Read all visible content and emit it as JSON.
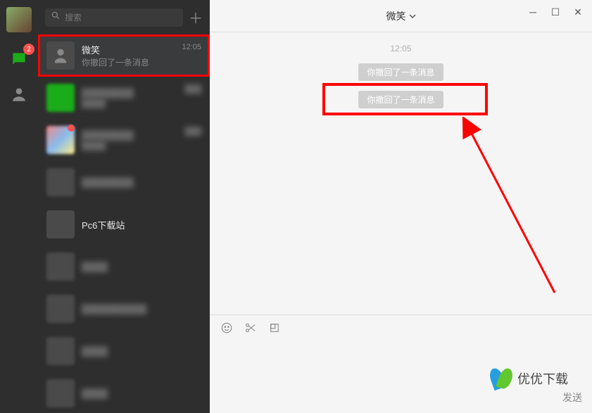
{
  "rail": {
    "badge": "2"
  },
  "search": {
    "placeholder": "搜索"
  },
  "chats": [
    {
      "title": "微笑",
      "sub": "你撤回了一条消息",
      "time": "12:05"
    },
    {
      "title": "Pc6下载站",
      "sub": "",
      "time": ""
    }
  ],
  "header": {
    "title": "微笑"
  },
  "timeline": {
    "time": "12:05",
    "sys1": "你撤回了一条消息",
    "sys2": "你撤回了一条消息"
  },
  "compose": {
    "send": "发送"
  },
  "watermark": "优优下载"
}
